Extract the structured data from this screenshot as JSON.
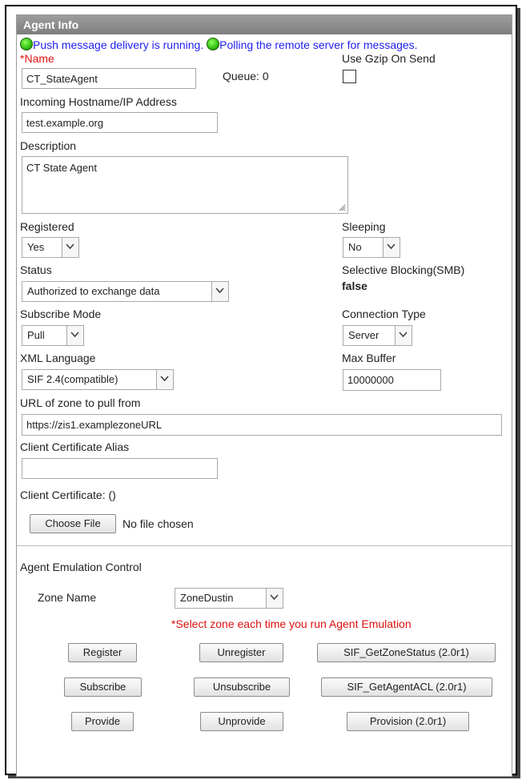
{
  "header": {
    "title": "Agent Info"
  },
  "status": {
    "push_text": "Push message delivery is running.",
    "poll_text": "Polling the remote server for messages."
  },
  "name": {
    "required_mark": "*",
    "label": "Name",
    "value": "CT_StateAgent"
  },
  "queue": {
    "text": "Queue: 0"
  },
  "gzip": {
    "label": "Use Gzip On Send",
    "checked": false
  },
  "hostname": {
    "label": "Incoming Hostname/IP Address",
    "value": "test.example.org"
  },
  "description": {
    "label": "Description",
    "value": "CT State Agent"
  },
  "registered": {
    "label": "Registered",
    "value": "Yes"
  },
  "sleeping": {
    "label": "Sleeping",
    "value": "No"
  },
  "status_field": {
    "label": "Status",
    "value": "Authorized to exchange data"
  },
  "smb": {
    "label": "Selective Blocking(SMB)",
    "value": "false"
  },
  "subscribe_mode": {
    "label": "Subscribe Mode",
    "value": "Pull"
  },
  "connection_type": {
    "label": "Connection Type",
    "value": "Server"
  },
  "xml_language": {
    "label": "XML Language",
    "value": "SIF 2.4(compatible)"
  },
  "max_buffer": {
    "label": "Max Buffer",
    "value": "10000000"
  },
  "zone_url": {
    "label": "URL of zone to pull from",
    "value": "https://zis1.examplezoneURL"
  },
  "cert_alias": {
    "label": "Client Certificate Alias",
    "value": ""
  },
  "cert": {
    "label": "Client Certificate: ()",
    "choose_label": "Choose File",
    "no_file": "No file chosen"
  },
  "emulation": {
    "title": "Agent Emulation Control",
    "zone_label": "Zone Name",
    "zone_value": "ZoneDustin",
    "note": "*Select zone each time you run Agent Emulation",
    "buttons": {
      "register": "Register",
      "unregister": "Unregister",
      "get_zone_status": "SIF_GetZoneStatus (2.0r1)",
      "subscribe": "Subscribe",
      "unsubscribe": "Unsubscribe",
      "get_agent_acl": "SIF_GetAgentACL (2.0r1)",
      "provide": "Provide",
      "unprovide": "Unprovide",
      "provision": "Provision (2.0r1)"
    }
  },
  "colors": {
    "header_bg": "#8c8c8c",
    "required": "#e01010",
    "status_text": "#1f1ff0",
    "status_dot": "#2fbf10"
  },
  "icons": {
    "status_dot": "green-circle",
    "dropdown": "chevron-down",
    "resize": "resize-grip"
  }
}
